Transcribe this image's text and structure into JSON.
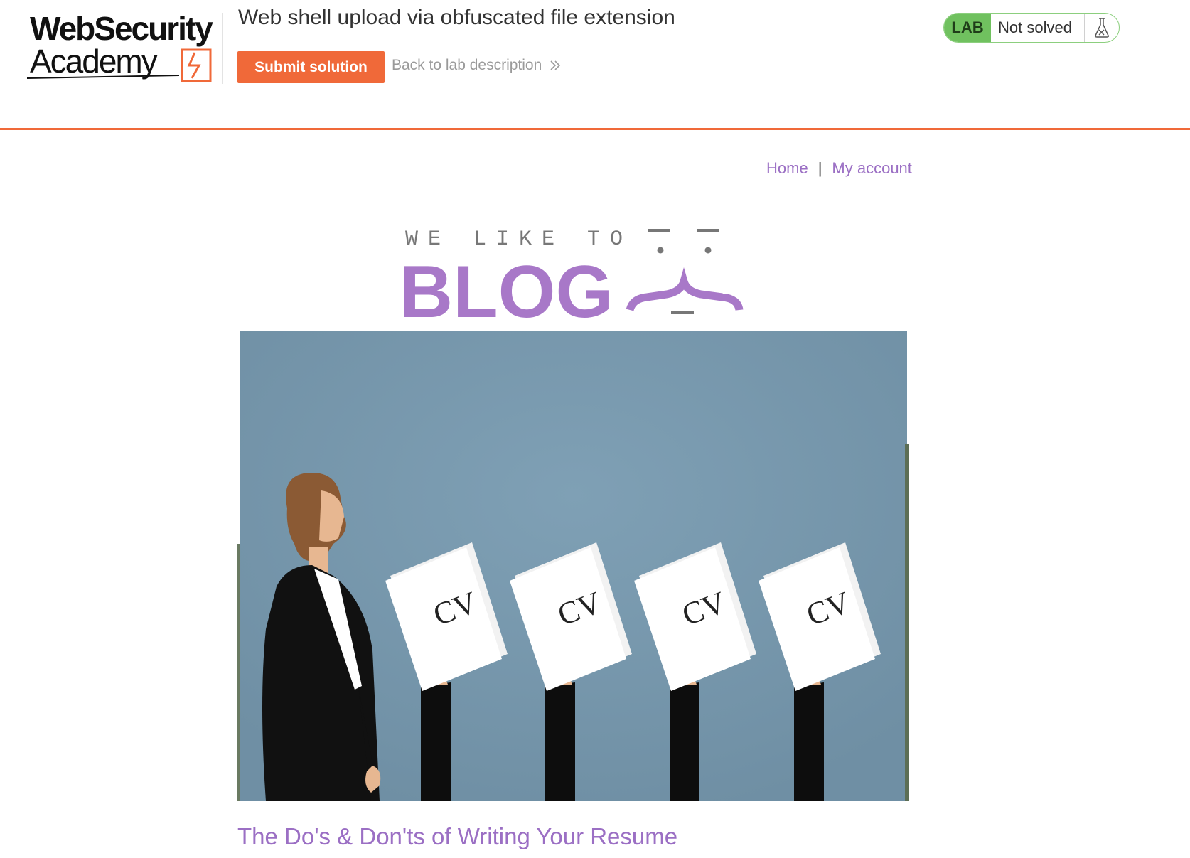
{
  "header": {
    "logo": {
      "line1": "WebSecurity",
      "line2": "Academy"
    },
    "lab_title": "Web shell upload via obfuscated file extension",
    "submit_label": "Submit solution",
    "back_label": "Back to lab description",
    "lab_badge": "LAB",
    "status": "Not solved",
    "status_icon": "flask-icon",
    "accent_color": "#f06939",
    "badge_color": "#70c15f"
  },
  "nav": {
    "home": "Home",
    "separator": "|",
    "account": "My account",
    "link_color": "#9b6fc4"
  },
  "banner": {
    "small_text": "WE LIKE TO",
    "big_text": "BLOG"
  },
  "hero": {
    "cv_labels": [
      "CV",
      "CV",
      "CV",
      "CV"
    ]
  },
  "post": {
    "title": "The Do's & Don'ts of Writing Your Resume"
  }
}
